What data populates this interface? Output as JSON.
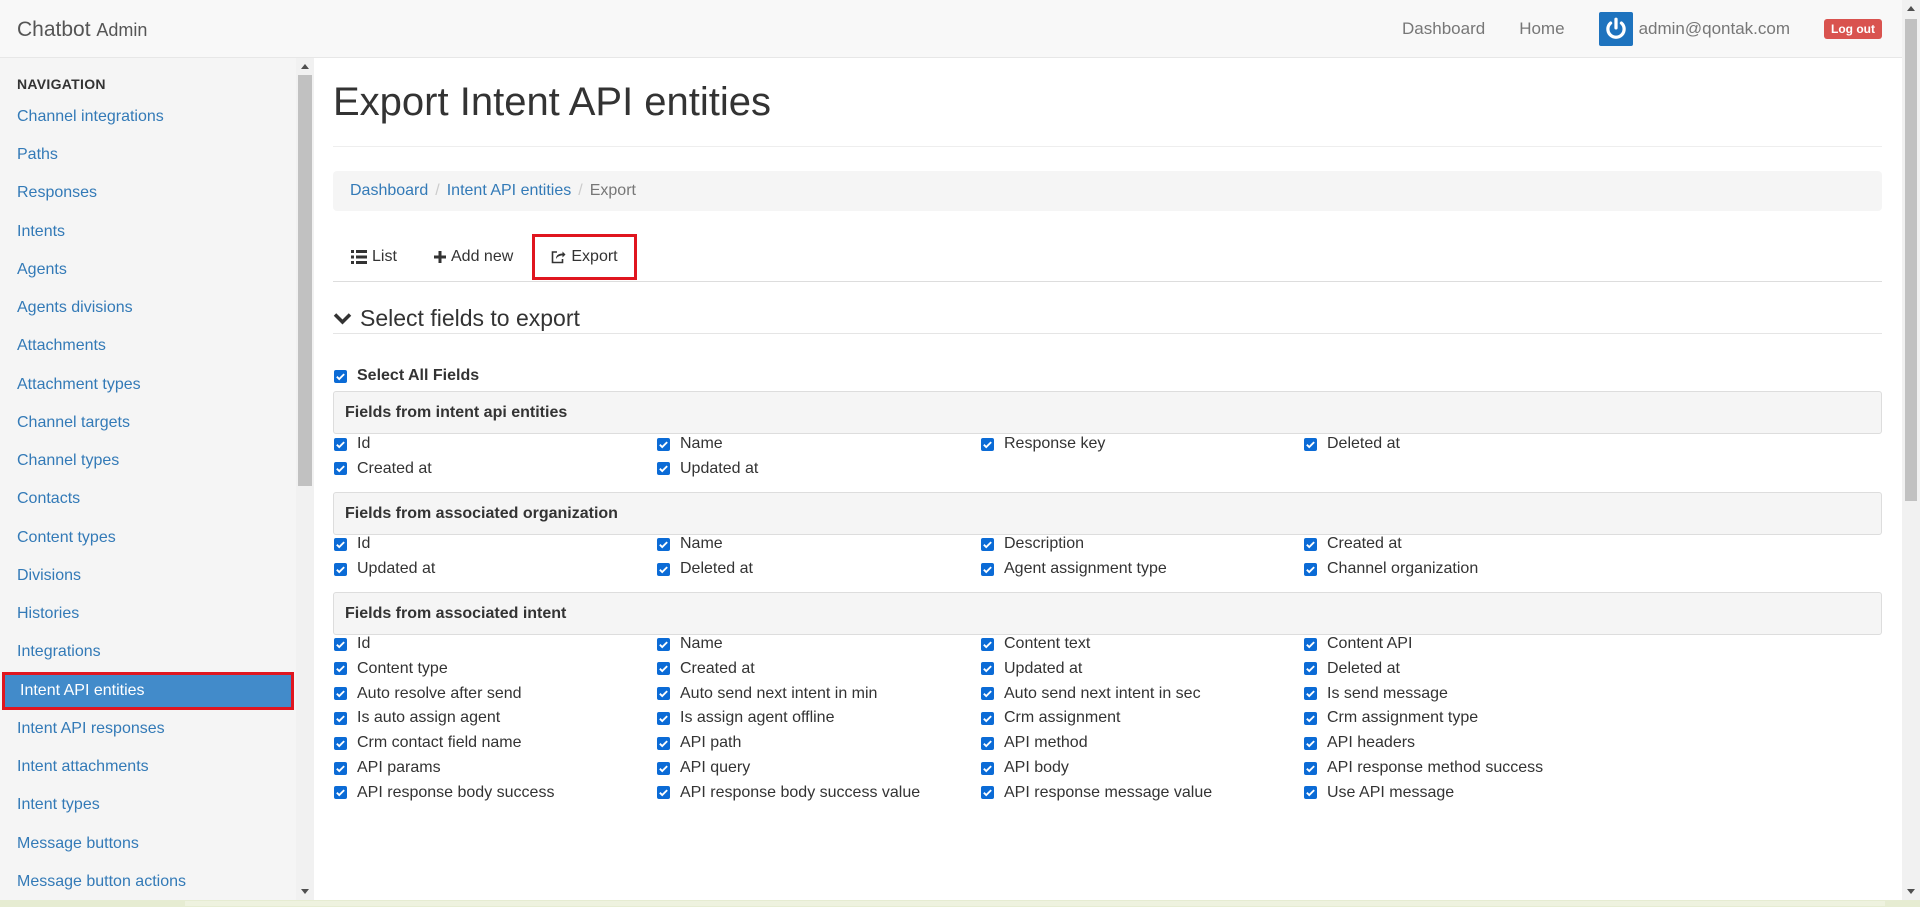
{
  "navbar": {
    "brand": "Chatbot",
    "brand_sub": "Admin",
    "links": [
      "Dashboard",
      "Home"
    ],
    "user_email": "admin@qontak.com",
    "logout_label": "Log out"
  },
  "sidebar": {
    "header": "NAVIGATION",
    "items": [
      "Channel integrations",
      "Paths",
      "Responses",
      "Intents",
      "Agents",
      "Agents divisions",
      "Attachments",
      "Attachment types",
      "Channel targets",
      "Channel types",
      "Contacts",
      "Content types",
      "Divisions",
      "Histories",
      "Integrations",
      "Intent API entities",
      "Intent API responses",
      "Intent attachments",
      "Intent types",
      "Message buttons",
      "Message button actions"
    ],
    "active_item": "Intent API entities"
  },
  "page": {
    "title": "Export Intent API entities",
    "breadcrumb": [
      "Dashboard",
      "Intent API entities",
      "Export"
    ],
    "tabs": {
      "list": "List",
      "add_new": "Add new",
      "export": "Export"
    },
    "section_title": "Select fields to export",
    "select_all": "Select All Fields"
  },
  "groups": [
    {
      "title": "Fields from intent api entities",
      "fields": [
        "Id",
        "Name",
        "Response key",
        "Deleted at",
        "Created at",
        "Updated at"
      ]
    },
    {
      "title": "Fields from associated organization",
      "fields": [
        "Id",
        "Name",
        "Description",
        "Created at",
        "Updated at",
        "Deleted at",
        "Agent assignment type",
        "Channel organization"
      ]
    },
    {
      "title": "Fields from associated intent",
      "fields": [
        "Id",
        "Name",
        "Content text",
        "Content API",
        "Content type",
        "Created at",
        "Updated at",
        "Deleted at",
        "Auto resolve after send",
        "Auto send next intent in min",
        "Auto send next intent in sec",
        "Is send message",
        "Is auto assign agent",
        "Is assign agent offline",
        "Crm assignment",
        "Crm assignment type",
        "Crm contact field name",
        "API path",
        "API method",
        "API headers",
        "API params",
        "API query",
        "API body",
        "API response method success",
        "API response body success",
        "API response body success value",
        "API response message value",
        "Use API message"
      ]
    }
  ],
  "colors": {
    "link": "#337ab7",
    "active_bg": "#428bca",
    "highlight_border": "#e0161f",
    "checkbox": "#0b6bd6",
    "logout": "#d9534f"
  }
}
